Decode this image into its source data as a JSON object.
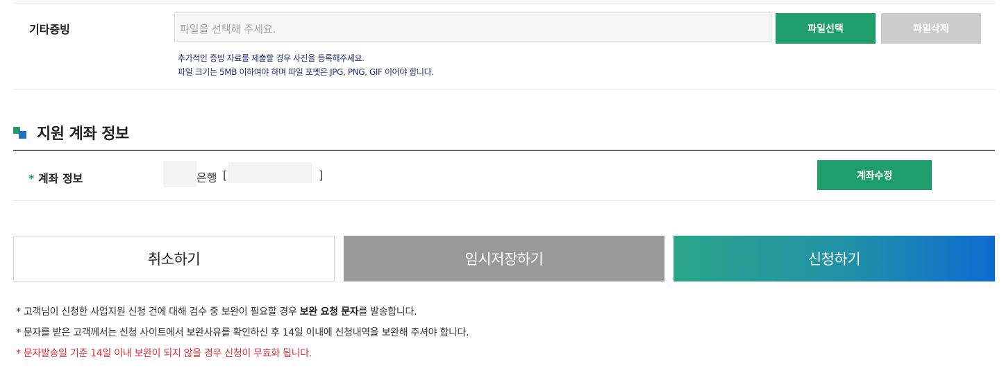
{
  "other_evidence": {
    "label": "기타증빙",
    "placeholder": "파일을 선택해 주세요.",
    "select_button": "파일선택",
    "delete_button": "파일삭제",
    "help_line1": "추가적인 증빙 자료를 제출할 경우 사진을 등록해주세요.",
    "help_line2": "파일 크기는 5MB 이하여야 하며 파일 포멧은 JPG, PNG, GIF 이어야 합니다."
  },
  "account_section": {
    "title": "지원 계좌 정보",
    "label_required": "*",
    "label": "계좌 정보",
    "bank_suffix": "은행",
    "bracket_open": "[",
    "bracket_close": "]",
    "edit_button": "계좌수정"
  },
  "actions": {
    "cancel": "취소하기",
    "temp_save": "임시저장하기",
    "apply": "신청하기"
  },
  "notes": {
    "note1_pre": "* 고객님이 신청한 사업지원 신청 건에 대해 검수 중 보완이 필요할 경우 ",
    "note1_bold": "보완 요청 문자",
    "note1_post": "를 발송합니다.",
    "note2": "* 문자를 받은 고객께서는 신청 사이트에서 보완사유를 확인하신 후 14일 이내에 신청내역을 보완해 주셔야 합니다.",
    "note3": "* 문자발송일 기준 14일 이내 보완이 되지 않을 경우 신청이 무효화 됩니다."
  },
  "colors": {
    "primary_green": "#1e9e6a",
    "disabled_gray": "#cccccc",
    "help_navy": "#1f2e78",
    "warning_red": "#e0313b",
    "apply_gradient_start": "#2aa68a",
    "apply_gradient_end": "#0e6bd0"
  }
}
